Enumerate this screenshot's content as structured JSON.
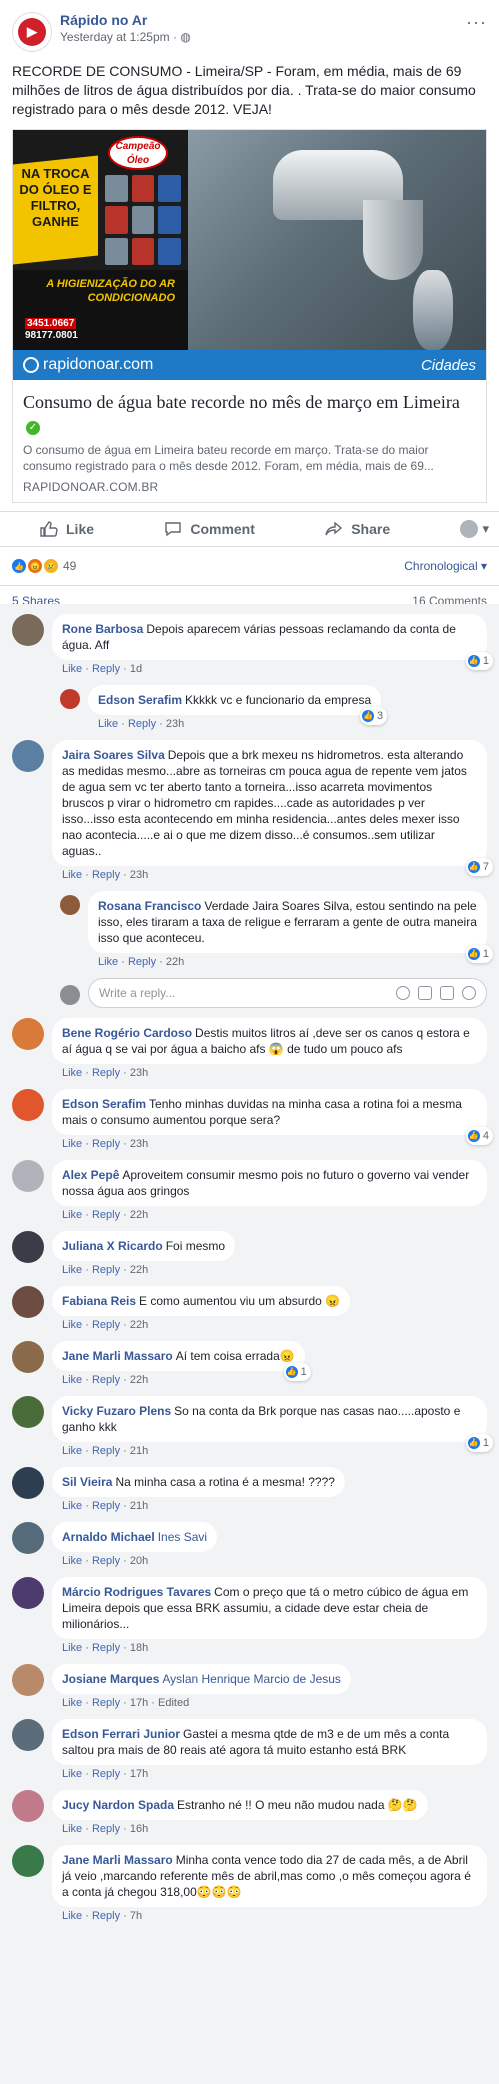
{
  "post": {
    "page_name": "Rápido no Ar",
    "time": "Yesterday at 1:25pm",
    "text": "RECORDE DE CONSUMO - Limeira/SP - Foram, em média, mais de 69 milhões de litros de água distribuídos por dia. . Trata-se do maior consumo registrado para o mês desde 2012. VEJA!",
    "ad": {
      "brand": "Campeão Óleo",
      "headline": "NA TROCA DO ÓLEO E FILTRO, GANHE",
      "hygiene": "A HIGIENIZAÇÃO DO AR CONDICIONADO",
      "phone1": "3451.0667",
      "phone2": "98177.0801"
    },
    "banner_left": "rapidonoar.com",
    "banner_right": "Cidades",
    "link": {
      "title": "Consumo de água bate recorde no mês de março em Limeira",
      "description": "O consumo de água em Limeira bateu recorde em março. Trata-se do maior consumo registrado para o mês desde 2012. Foram, em média, mais de 69...",
      "domain": "RAPIDONOAR.COM.BR"
    },
    "actions": {
      "like": "Like",
      "comment": "Comment",
      "share": "Share"
    },
    "reactions_count": "49",
    "sort": "Chronological ▾",
    "shares": "5 Shares",
    "comments_count": "16 Comments"
  },
  "reply_placeholder": "Write a reply...",
  "labels": {
    "like": "Like",
    "reply": "Reply",
    "edited": "Edited"
  },
  "comments": [
    {
      "author": "Rone Barbosa",
      "text": "Depois aparecem várias pessoas reclamando da conta de água. Aff",
      "time": "1d",
      "likes": "1"
    },
    {
      "author": "Edson Serafim",
      "text": "Kkkkk vc e funcionario da empresa",
      "time": "23h",
      "likes": "3"
    },
    {
      "author": "Jaira Soares Silva",
      "text": "Depois que a brk mexeu ns hidrometros. esta alterando as medidas mesmo...abre as torneiras cm pouca agua de repente vem jatos de agua sem vc ter aberto tanto a torneira...isso acarreta movimentos bruscos p virar o hidrometro cm rapides....cade as autoridades p ver isso...isso esta acontecendo em minha residencia...antes deles mexer isso nao acontecia.....e ai o que me dizem disso...é consumos..sem utilizar aguas..",
      "time": "23h",
      "likes": "7"
    },
    {
      "author": "Rosana Francisco",
      "text": "Verdade Jaira Soares Silva, estou sentindo na pele isso, eles tiraram a taxa de religue e ferraram a gente de outra maneira isso que aconteceu.",
      "time": "22h",
      "likes": "1"
    },
    {
      "author": "Bene Rogério Cardoso",
      "text": "Destis muitos litros aí ,deve ser os canos q estora e aí água q se vai por água a baicho afs 😱 de tudo um pouco afs",
      "time": "23h"
    },
    {
      "author": "Edson Serafim",
      "text": "Tenho minhas duvidas na minha casa a rotina foi a mesma mais o consumo aumentou porque sera?",
      "time": "23h",
      "likes": "4"
    },
    {
      "author": "Alex Pepê",
      "text": "Aproveitem consumir mesmo pois no futuro o governo vai vender nossa água aos gringos",
      "time": "22h"
    },
    {
      "author": "Juliana X Ricardo",
      "text": "Foi mesmo",
      "time": "22h"
    },
    {
      "author": "Fabiana Reis",
      "text": "E como aumentou viu um absurdo 😠",
      "time": "22h"
    },
    {
      "author": "Jane Marli Massaro",
      "text": "Aí tem coisa errada😠",
      "time": "22h",
      "likes": "1"
    },
    {
      "author": "Vicky Fuzaro Plens",
      "text": "So na conta da Brk porque nas casas nao.....aposto e ganho kkk",
      "time": "21h",
      "likes": "1"
    },
    {
      "author": "Sil Vieira",
      "text": "Na minha casa a rotina é a mesma! ????",
      "time": "21h"
    },
    {
      "author": "Arnaldo Michael",
      "text": "Ines Savi",
      "time": "20h"
    },
    {
      "author": "Márcio Rodrigues Tavares",
      "text": "Com o preço que tá o metro cúbico de água em Limeira depois que essa BRK assumiu, a cidade deve estar cheia de milionários...",
      "time": "18h"
    },
    {
      "author": "Josiane Marques",
      "text": "Ayslan Henrique Marcio de Jesus",
      "time": "17h"
    },
    {
      "author": "Edson Ferrari Junior",
      "text": "Gastei a mesma qtde de m3 e de um mês a conta saltou pra mais de 80 reais até agora tá muito estanho está BRK",
      "time": "17h"
    },
    {
      "author": "Jucy Nardon Spada",
      "text": "Estranho né !! O meu não mudou nada 🤔🤔",
      "time": "16h"
    },
    {
      "author": "Jane Marli Massaro",
      "text": "Minha conta vence todo dia 27 de cada mês, a de Abril já veio ,marcando referente mês de abril,mas como ,o mês começou agora é a conta já chegou 318,00😳😳😳",
      "time": "7h"
    }
  ],
  "colors": {
    "link": "#385898",
    "comment_bg": "#f2f3f5",
    "banner": "#1e79c7",
    "like_blue": "#1877f2"
  }
}
